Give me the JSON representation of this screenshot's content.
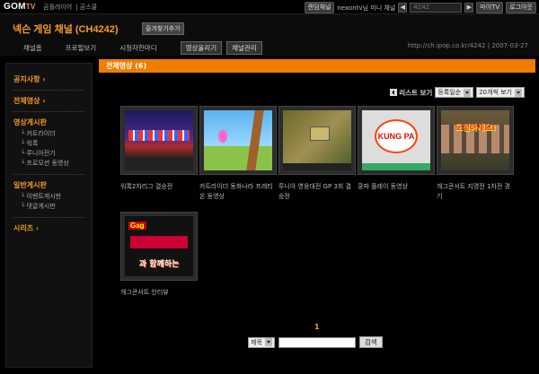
{
  "topbar": {
    "logo_main": "GOM",
    "logo_sub": "TV",
    "nav": [
      "곰플레이어",
      "곰스쿨"
    ],
    "channel_pill": "랜덤채널",
    "user_channel": "nexontv님 미니 채널",
    "channel_number": "4242",
    "my_tv": "마이TV",
    "logout": "로그아웃"
  },
  "header": {
    "title": "넥슨 게임 채널 (CH4242)",
    "favorite_label": "즐겨찾기추가",
    "menu": [
      "채널홈",
      "프로필보기",
      "시청자한마디"
    ],
    "upload_button": "영상올리기",
    "manage_button": "채널관리",
    "url": "http://ch.ipop.co.kr/4242 | 2007-03-27"
  },
  "sidebar": {
    "sections": [
      {
        "label": "공지사항 ›",
        "children": []
      },
      {
        "label": "전체영상 ›",
        "children": []
      },
      {
        "label": "영상게시판",
        "children": [
          "카트라이더",
          "워록",
          "루니아전기",
          "프로모션 동영상"
        ]
      },
      {
        "label": "일반게시판",
        "children": [
          "이벤트게시판",
          "댓글게시판"
        ]
      },
      {
        "label": "시리즈 ›",
        "children": []
      }
    ]
  },
  "content": {
    "tab_title": "전체영상 (6)",
    "list_view": "리스트 보기",
    "sort_selected": "등록일순",
    "per_page_selected": "20개씩 보기",
    "videos": [
      {
        "caption": "워록2차리그 결승전"
      },
      {
        "caption": "카트라이더 동화나라 프레티온 동영상"
      },
      {
        "caption": "루니아 영웅대전 GP 3회 결승전"
      },
      {
        "caption": "쿵파 플레이 동영상"
      },
      {
        "caption": "개그콘서트 지명전 1차전 경기"
      },
      {
        "caption": "개그콘서트 인터뷰"
      }
    ],
    "thumb_text": {
      "kungpa": "KUNG PA",
      "dojeon": "도전하세요!",
      "gag": "Gag",
      "big": "과 함께하는"
    },
    "pager": "1",
    "search_select": "제목",
    "search_button": "검색"
  }
}
